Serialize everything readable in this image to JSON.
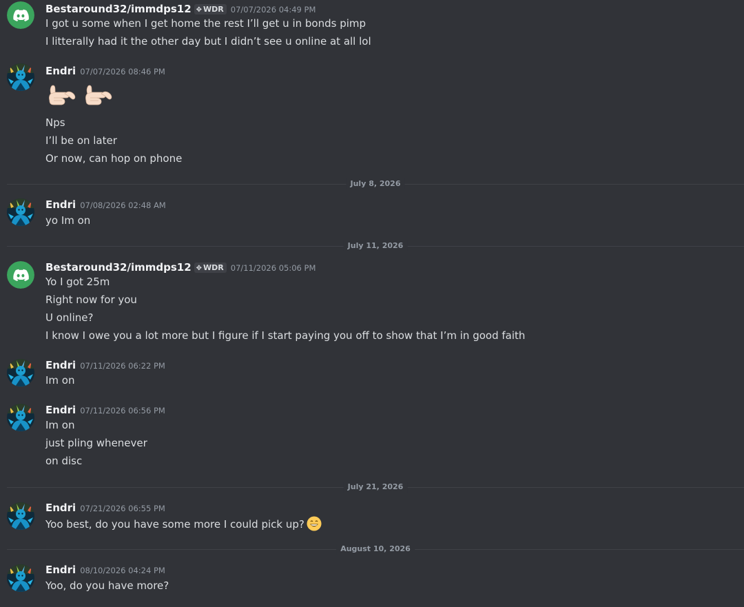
{
  "users": {
    "best": {
      "name": "Bestaround32/immdps12",
      "tag": "WDR",
      "avatar_icon": "discord-logo-icon",
      "avatar_color": "#3ba55d"
    },
    "endri": {
      "name": "Endri",
      "avatar_icon": "character-art-avatar"
    }
  },
  "messages": [
    {
      "author": "Bestaround32/immdps12",
      "tag": "WDR",
      "time": "07/07/2026 04:49 PM",
      "lines": [
        "I got u some when I get home the rest I’ll get u in bonds pimp",
        "I litterally had it the other day but I didn’t see u online at all lol"
      ]
    },
    {
      "author": "Endri",
      "time": "07/07/2026 08:46 PM",
      "emoji": "call-me-hand-emoji x2",
      "lines": [
        "Nps",
        "I’ll be on later",
        "Or now, can hop on phone"
      ]
    },
    {
      "author": "Endri",
      "time": "07/08/2026 02:48 AM",
      "lines": [
        "yo Im on"
      ]
    },
    {
      "author": "Bestaround32/immdps12",
      "tag": "WDR",
      "time": "07/11/2026 05:06 PM",
      "lines": [
        "Yo I got 25m",
        "Right now for you",
        "U online?",
        "I know I owe you a lot more but I figure if I start paying you off to show that I’m in good faith"
      ]
    },
    {
      "author": "Endri",
      "time": "07/11/2026 06:22 PM",
      "lines": [
        "Im on"
      ]
    },
    {
      "author": "Endri",
      "time": "07/11/2026 06:56 PM",
      "lines": [
        "Im on",
        "just pling whenever",
        "on disc"
      ]
    },
    {
      "author": "Endri",
      "time": "07/21/2026 06:55 PM",
      "lines": [
        "Yoo best, do you have some more I could pick up?"
      ],
      "trailing_emoji": "grinning-face-emoji"
    },
    {
      "author": "Endri",
      "time": "08/10/2026 04:24 PM",
      "lines": [
        "Yoo, do you have more?"
      ]
    }
  ],
  "dividers": [
    "July 8, 2026",
    "July 11, 2026",
    "July 21, 2026",
    "August 10, 2026"
  ]
}
